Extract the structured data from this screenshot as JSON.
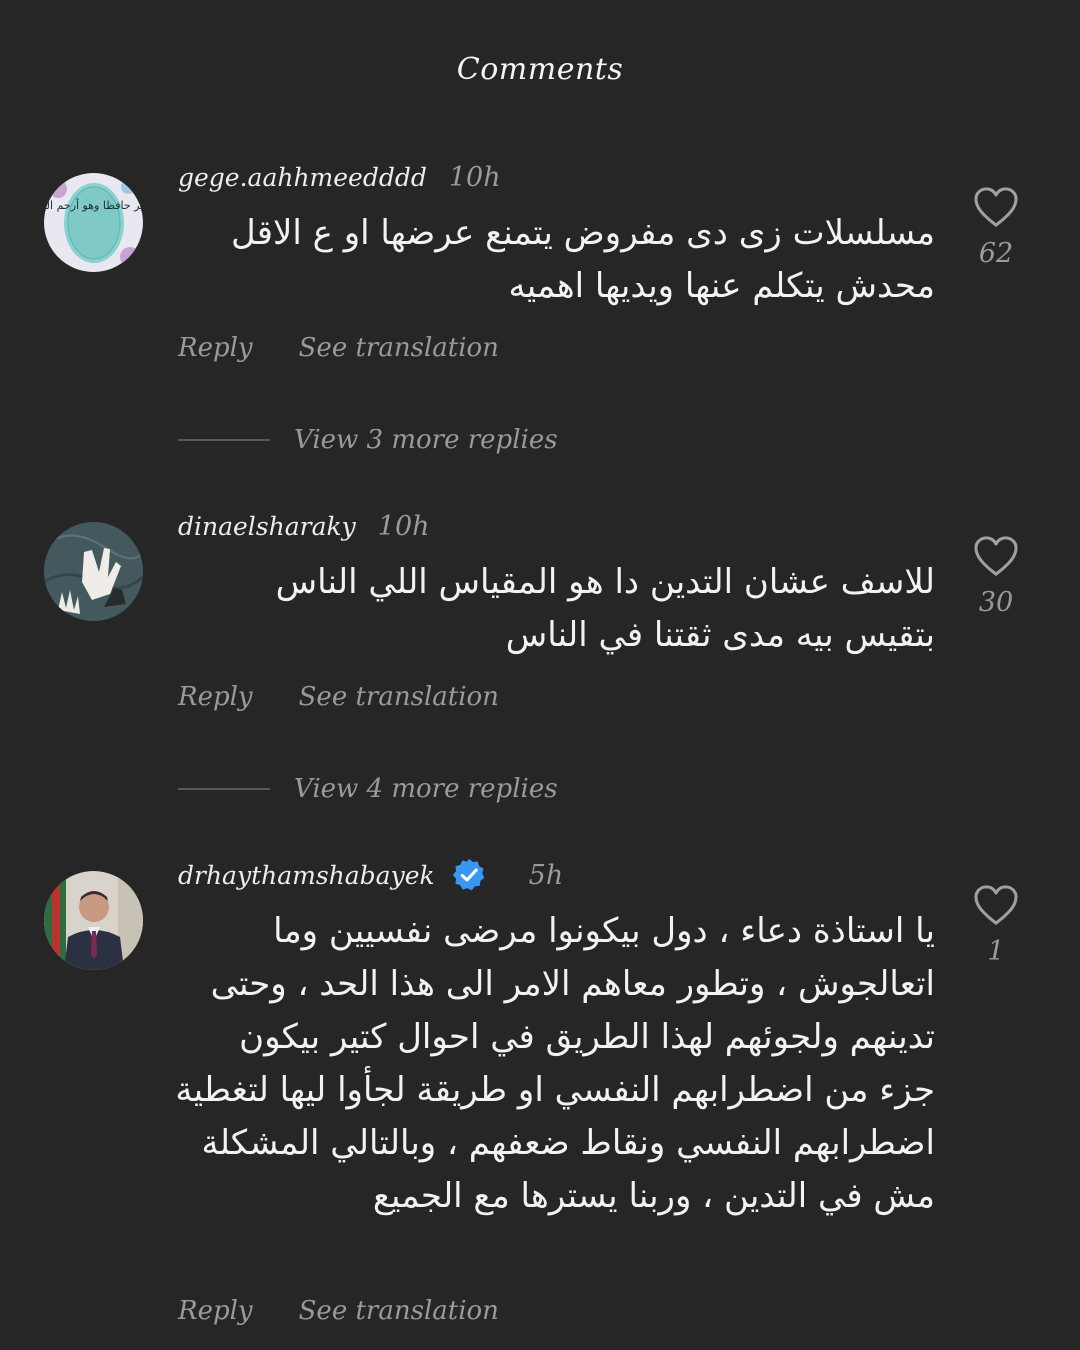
{
  "header": {
    "title": "Comments"
  },
  "comments": [
    {
      "username": "gege.aahhmeedddd",
      "time": "10h",
      "verified": false,
      "text": "مسلسلات زى دى مفروض يتمنع عرضها او ع الاقل محدش يتكلم عنها ويديها اهميه",
      "likes": "62",
      "reply_label": "Reply",
      "translate_label": "See translation",
      "view_replies": "View 3 more replies",
      "avatar_text": "فالله خير حافظا وهو أرحم الراحمين"
    },
    {
      "username": "dinaelsharaky",
      "time": "10h",
      "verified": false,
      "text": "للاسف عشان التدين دا هو المقياس اللي الناس بتقيس بيه مدى ثقتنا في الناس",
      "likes": "30",
      "reply_label": "Reply",
      "translate_label": "See translation",
      "view_replies": "View 4 more replies"
    },
    {
      "username": "drhaythamshabayek",
      "time": "5h",
      "verified": true,
      "text": "يا استاذة دعاء ، دول بيكونوا مرضى نفسيين وما اتعالجوش ، وتطور معاهم الامر الى هذا الحد ، وحتى تدينهم ولجوئهم لهذا الطريق في احوال كتير بيكون جزء من اضطرابهم النفسي او طريقة لجأوا ليها لتغطية اضطرابهم النفسي ونقاط ضعفهم ، وبالتالي المشكلة مش في التدين ، وربنا يسترها مع الجميع",
      "likes": "1",
      "reply_label": "Reply",
      "translate_label": "See translation"
    }
  ],
  "colors": {
    "background": "#262626",
    "primary_text": "#f2f2f2",
    "secondary_text": "#9a9a9a",
    "verified_badge": "#3897f0"
  }
}
